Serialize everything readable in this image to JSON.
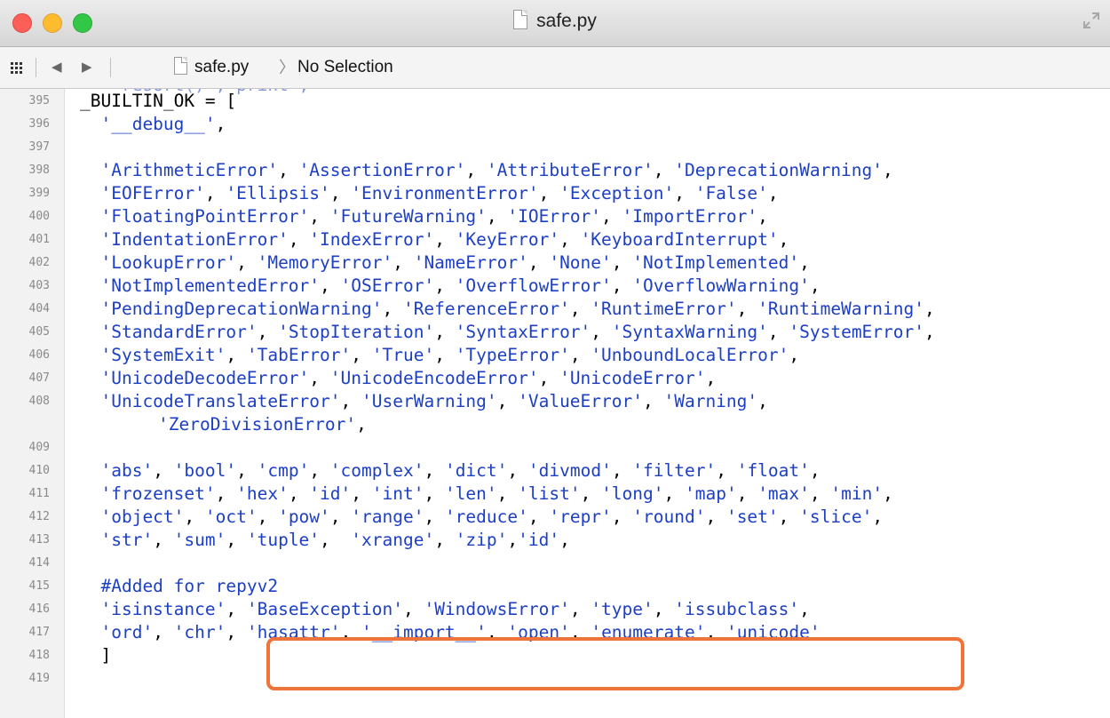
{
  "window": {
    "title": "safe.py",
    "icons": [
      "document-icon",
      "fullscreen-icon"
    ]
  },
  "jumpbar": {
    "file": "safe.py",
    "separator": "〉",
    "selection": "No Selection",
    "back_icon": "◀",
    "forward_icon": "▶"
  },
  "editor": {
    "top_partial": "    resort() , print ,",
    "lines": [
      {
        "n": "395",
        "text": "_BUILTIN_OK = ["
      },
      {
        "n": "396",
        "text": "  '__debug__',"
      },
      {
        "n": "397",
        "text": ""
      },
      {
        "n": "398",
        "text": "  'ArithmeticError', 'AssertionError', 'AttributeError', 'DeprecationWarning',"
      },
      {
        "n": "399",
        "text": "  'EOFError', 'Ellipsis', 'EnvironmentError', 'Exception', 'False',"
      },
      {
        "n": "400",
        "text": "  'FloatingPointError', 'FutureWarning', 'IOError', 'ImportError',"
      },
      {
        "n": "401",
        "text": "  'IndentationError', 'IndexError', 'KeyError', 'KeyboardInterrupt',"
      },
      {
        "n": "402",
        "text": "  'LookupError', 'MemoryError', 'NameError', 'None', 'NotImplemented',"
      },
      {
        "n": "403",
        "text": "  'NotImplementedError', 'OSError', 'OverflowError', 'OverflowWarning',"
      },
      {
        "n": "404",
        "text": "  'PendingDeprecationWarning', 'ReferenceError', 'RuntimeError', 'RuntimeWarning',"
      },
      {
        "n": "405",
        "text": "  'StandardError', 'StopIteration', 'SyntaxError', 'SyntaxWarning', 'SystemError',"
      },
      {
        "n": "406",
        "text": "  'SystemExit', 'TabError', 'True', 'TypeError', 'UnboundLocalError',"
      },
      {
        "n": "407",
        "text": "  'UnicodeDecodeError', 'UnicodeEncodeError', 'UnicodeError',"
      },
      {
        "n": "408",
        "text": "  'UnicodeTranslateError', 'UserWarning', 'ValueError', 'Warning',"
      },
      {
        "n": "",
        "text": "'ZeroDivisionError',",
        "continuation": true
      },
      {
        "n": "409",
        "text": ""
      },
      {
        "n": "410",
        "text": "  'abs', 'bool', 'cmp', 'complex', 'dict', 'divmod', 'filter', 'float',"
      },
      {
        "n": "411",
        "text": "  'frozenset', 'hex', 'id', 'int', 'len', 'list', 'long', 'map', 'max', 'min',"
      },
      {
        "n": "412",
        "text": "  'object', 'oct', 'pow', 'range', 'reduce', 'repr', 'round', 'set', 'slice',"
      },
      {
        "n": "413",
        "text": "  'str', 'sum', 'tuple',  'xrange', 'zip','id',"
      },
      {
        "n": "414",
        "text": ""
      },
      {
        "n": "415",
        "text": "  #Added for repyv2"
      },
      {
        "n": "416",
        "text": "  'isinstance', 'BaseException', 'WindowsError', 'type', 'issubclass',"
      },
      {
        "n": "417",
        "text": "  'ord', 'chr', 'hasattr', '__import__', 'open', 'enumerate', 'unicode'"
      },
      {
        "n": "418",
        "text": "  ]"
      },
      {
        "n": "419",
        "text": ""
      }
    ]
  },
  "annotation": {
    "highlight_color": "#f0743a"
  }
}
